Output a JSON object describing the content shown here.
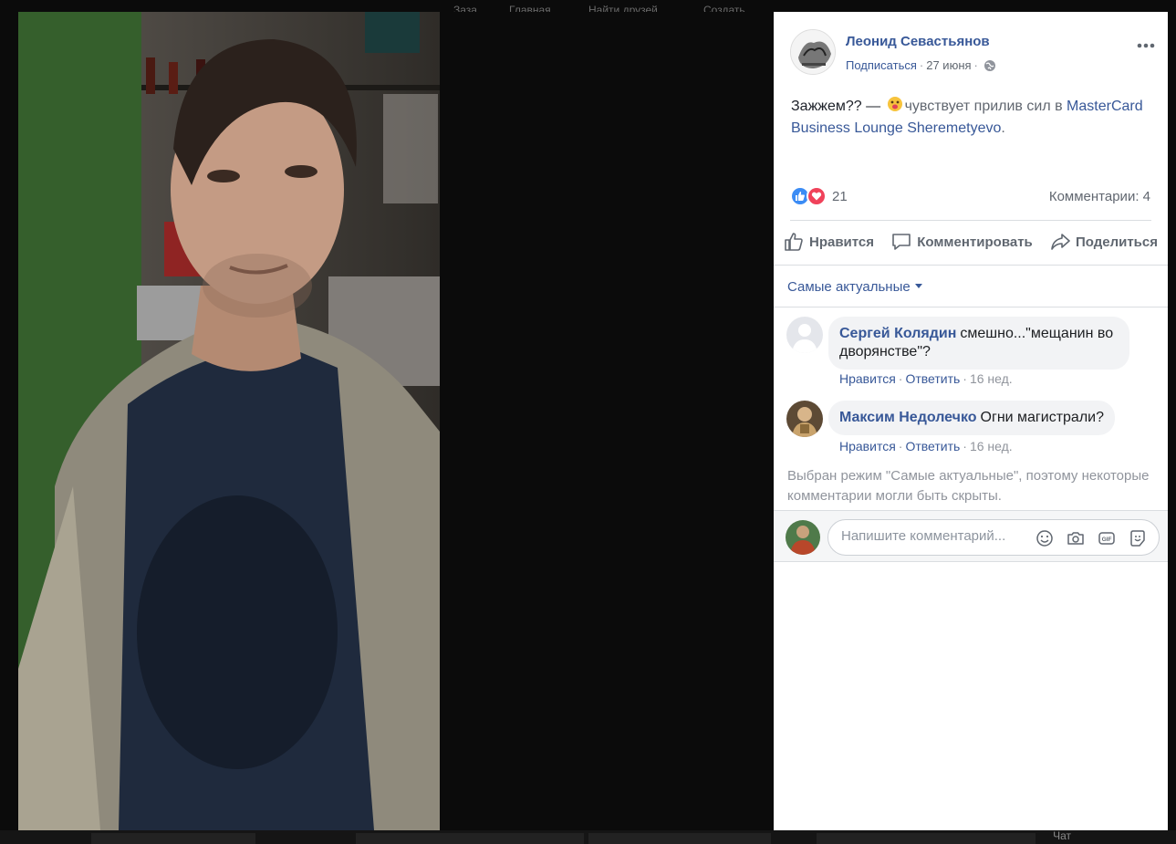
{
  "background_nav": [
    "Заза",
    "Главная",
    "Найти друзей",
    "Создать"
  ],
  "background_chat": "Чат",
  "post": {
    "author": "Леонид Севастьянов",
    "subscribe": "Подписаться",
    "date": "27 июня",
    "text_start": "Зажжем?? — ",
    "feeling": "чувствует прилив сил в",
    "place": "MasterCard Business Lounge Sheremetyevo",
    "text_end": ".",
    "reactions_count": "21",
    "comments_count": "Комментарии: 4"
  },
  "actions": {
    "like": "Нравится",
    "comment": "Комментировать",
    "share": "Поделиться"
  },
  "sort_label": "Самые актуальные",
  "comments": [
    {
      "name": "Сергей Колядин",
      "text": "смешно...\"мещанин во дворянстве\"?",
      "like": "Нравится",
      "reply": "Ответить",
      "time": "16 нед."
    },
    {
      "name": "Максим Недолечко",
      "text": "Огни магистрали?",
      "like": "Нравится",
      "reply": "Ответить",
      "time": "16 нед."
    }
  ],
  "filter_note": "Выбран режим \"Самые актуальные\", поэтому некоторые комментарии могли быть скрыты.",
  "composer": {
    "placeholder": "Напишите комментарий..."
  },
  "colors": {
    "link": "#385898",
    "muted": "#90949c",
    "like_blue": "#3b8cf5",
    "love_red": "#f0425a"
  }
}
